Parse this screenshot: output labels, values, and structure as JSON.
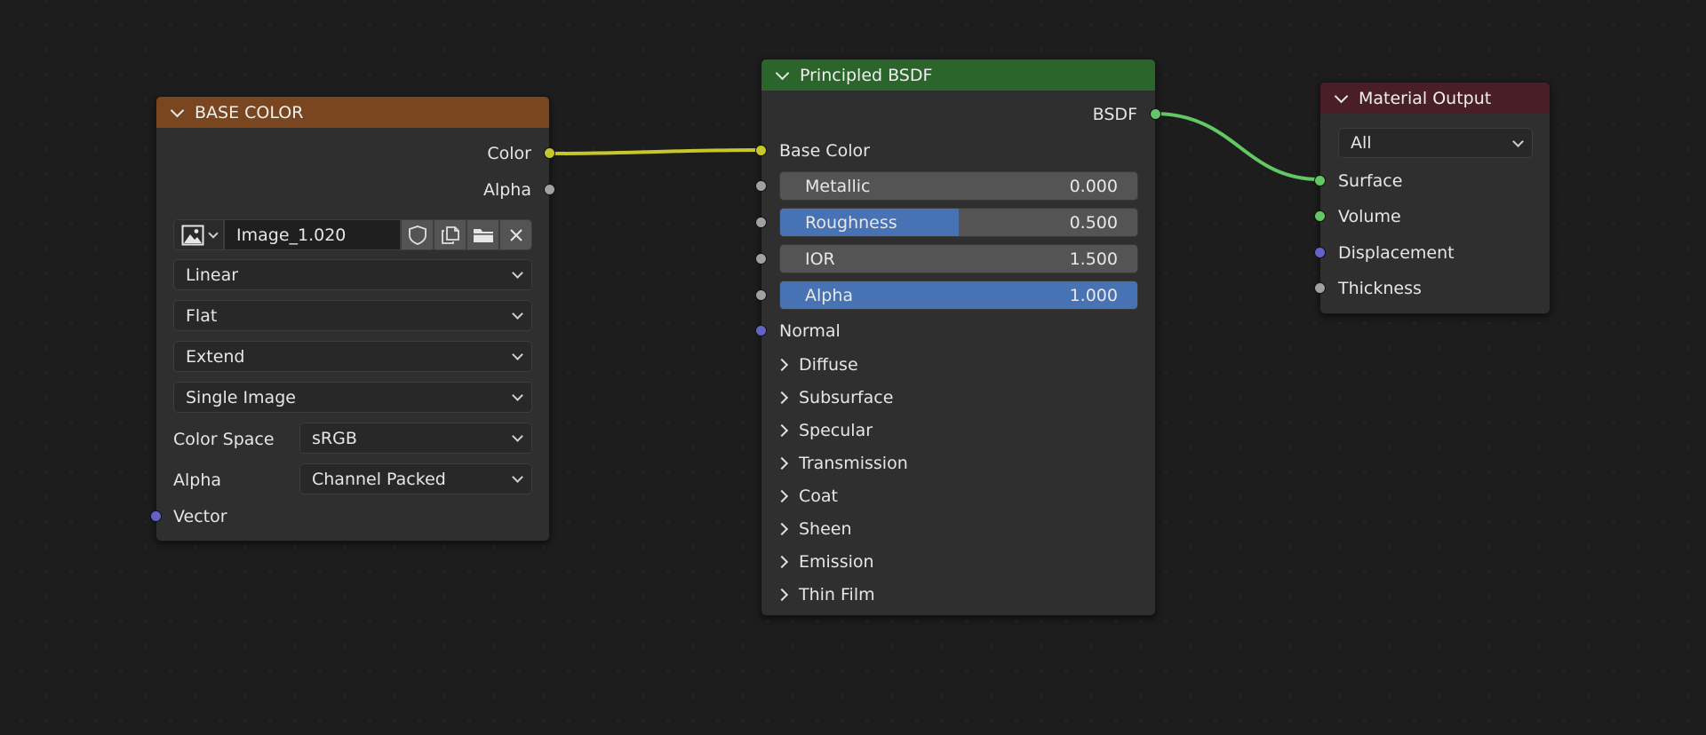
{
  "colors": {
    "texture_header": "#7a461f",
    "shader_header": "#2b652b",
    "output_header": "#4a1e26",
    "link_color": "#c7c729",
    "link_shader": "#63c763",
    "slider_fill": "#4772b3"
  },
  "image_node": {
    "title": "BASE COLOR",
    "outputs": [
      {
        "label": "Color",
        "socket": "yellow"
      },
      {
        "label": "Alpha",
        "socket": "grey"
      }
    ],
    "image_name": "Image_1.020",
    "icons": [
      "image-icon",
      "shield-icon",
      "duplicate-icon",
      "folder-icon",
      "close-icon"
    ],
    "interpolation": "Linear",
    "projection": "Flat",
    "extension": "Extend",
    "source": "Single Image",
    "color_space_label": "Color Space",
    "color_space_value": "sRGB",
    "alpha_label": "Alpha",
    "alpha_value": "Channel Packed",
    "vector_label": "Vector"
  },
  "bsdf_node": {
    "title": "Principled BSDF",
    "output_label": "BSDF",
    "base_color_label": "Base Color",
    "sliders": [
      {
        "label": "Metallic",
        "value": "0.000",
        "fraction": 0.0
      },
      {
        "label": "Roughness",
        "value": "0.500",
        "fraction": 0.5
      },
      {
        "label": "IOR",
        "value": "1.500",
        "fraction": 0.0
      },
      {
        "label": "Alpha",
        "value": "1.000",
        "fraction": 1.0
      }
    ],
    "normal_label": "Normal",
    "panels": [
      "Diffuse",
      "Subsurface",
      "Specular",
      "Transmission",
      "Coat",
      "Sheen",
      "Emission",
      "Thin Film"
    ]
  },
  "output_node": {
    "title": "Material Output",
    "target": "All",
    "inputs": [
      {
        "label": "Surface",
        "socket": "green"
      },
      {
        "label": "Volume",
        "socket": "green"
      },
      {
        "label": "Displacement",
        "socket": "purple"
      },
      {
        "label": "Thickness",
        "socket": "grey"
      }
    ]
  }
}
